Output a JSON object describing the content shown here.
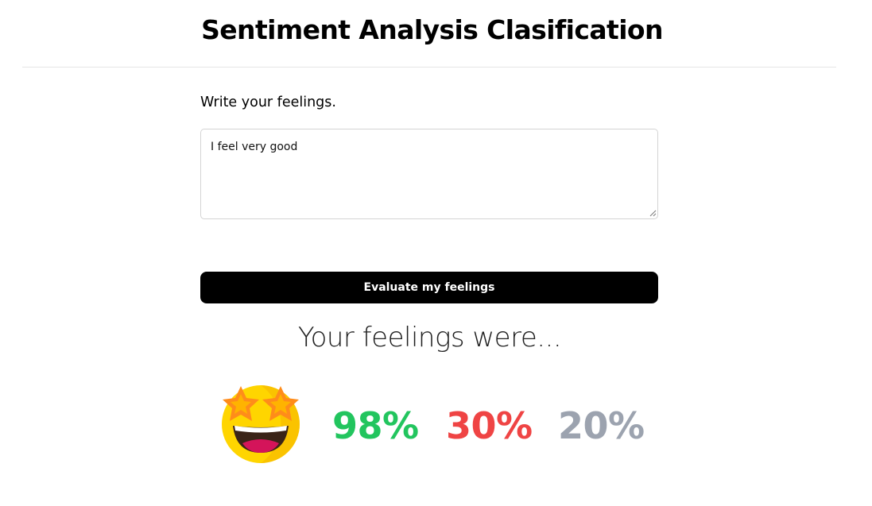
{
  "header": {
    "title": "Sentiment Analysis Clasification"
  },
  "form": {
    "prompt_label": "Write your feelings.",
    "textarea_value": "I feel very good",
    "submit_label": "Evaluate my feelings"
  },
  "result": {
    "heading": "Your feelings were...",
    "emoji_icon": "star-struck-face-icon",
    "scores": {
      "positive": "98%",
      "negative": "30%",
      "neutral": "20%"
    },
    "colors": {
      "positive": "#22c55e",
      "negative": "#ef4444",
      "neutral": "#9ca3af"
    }
  }
}
